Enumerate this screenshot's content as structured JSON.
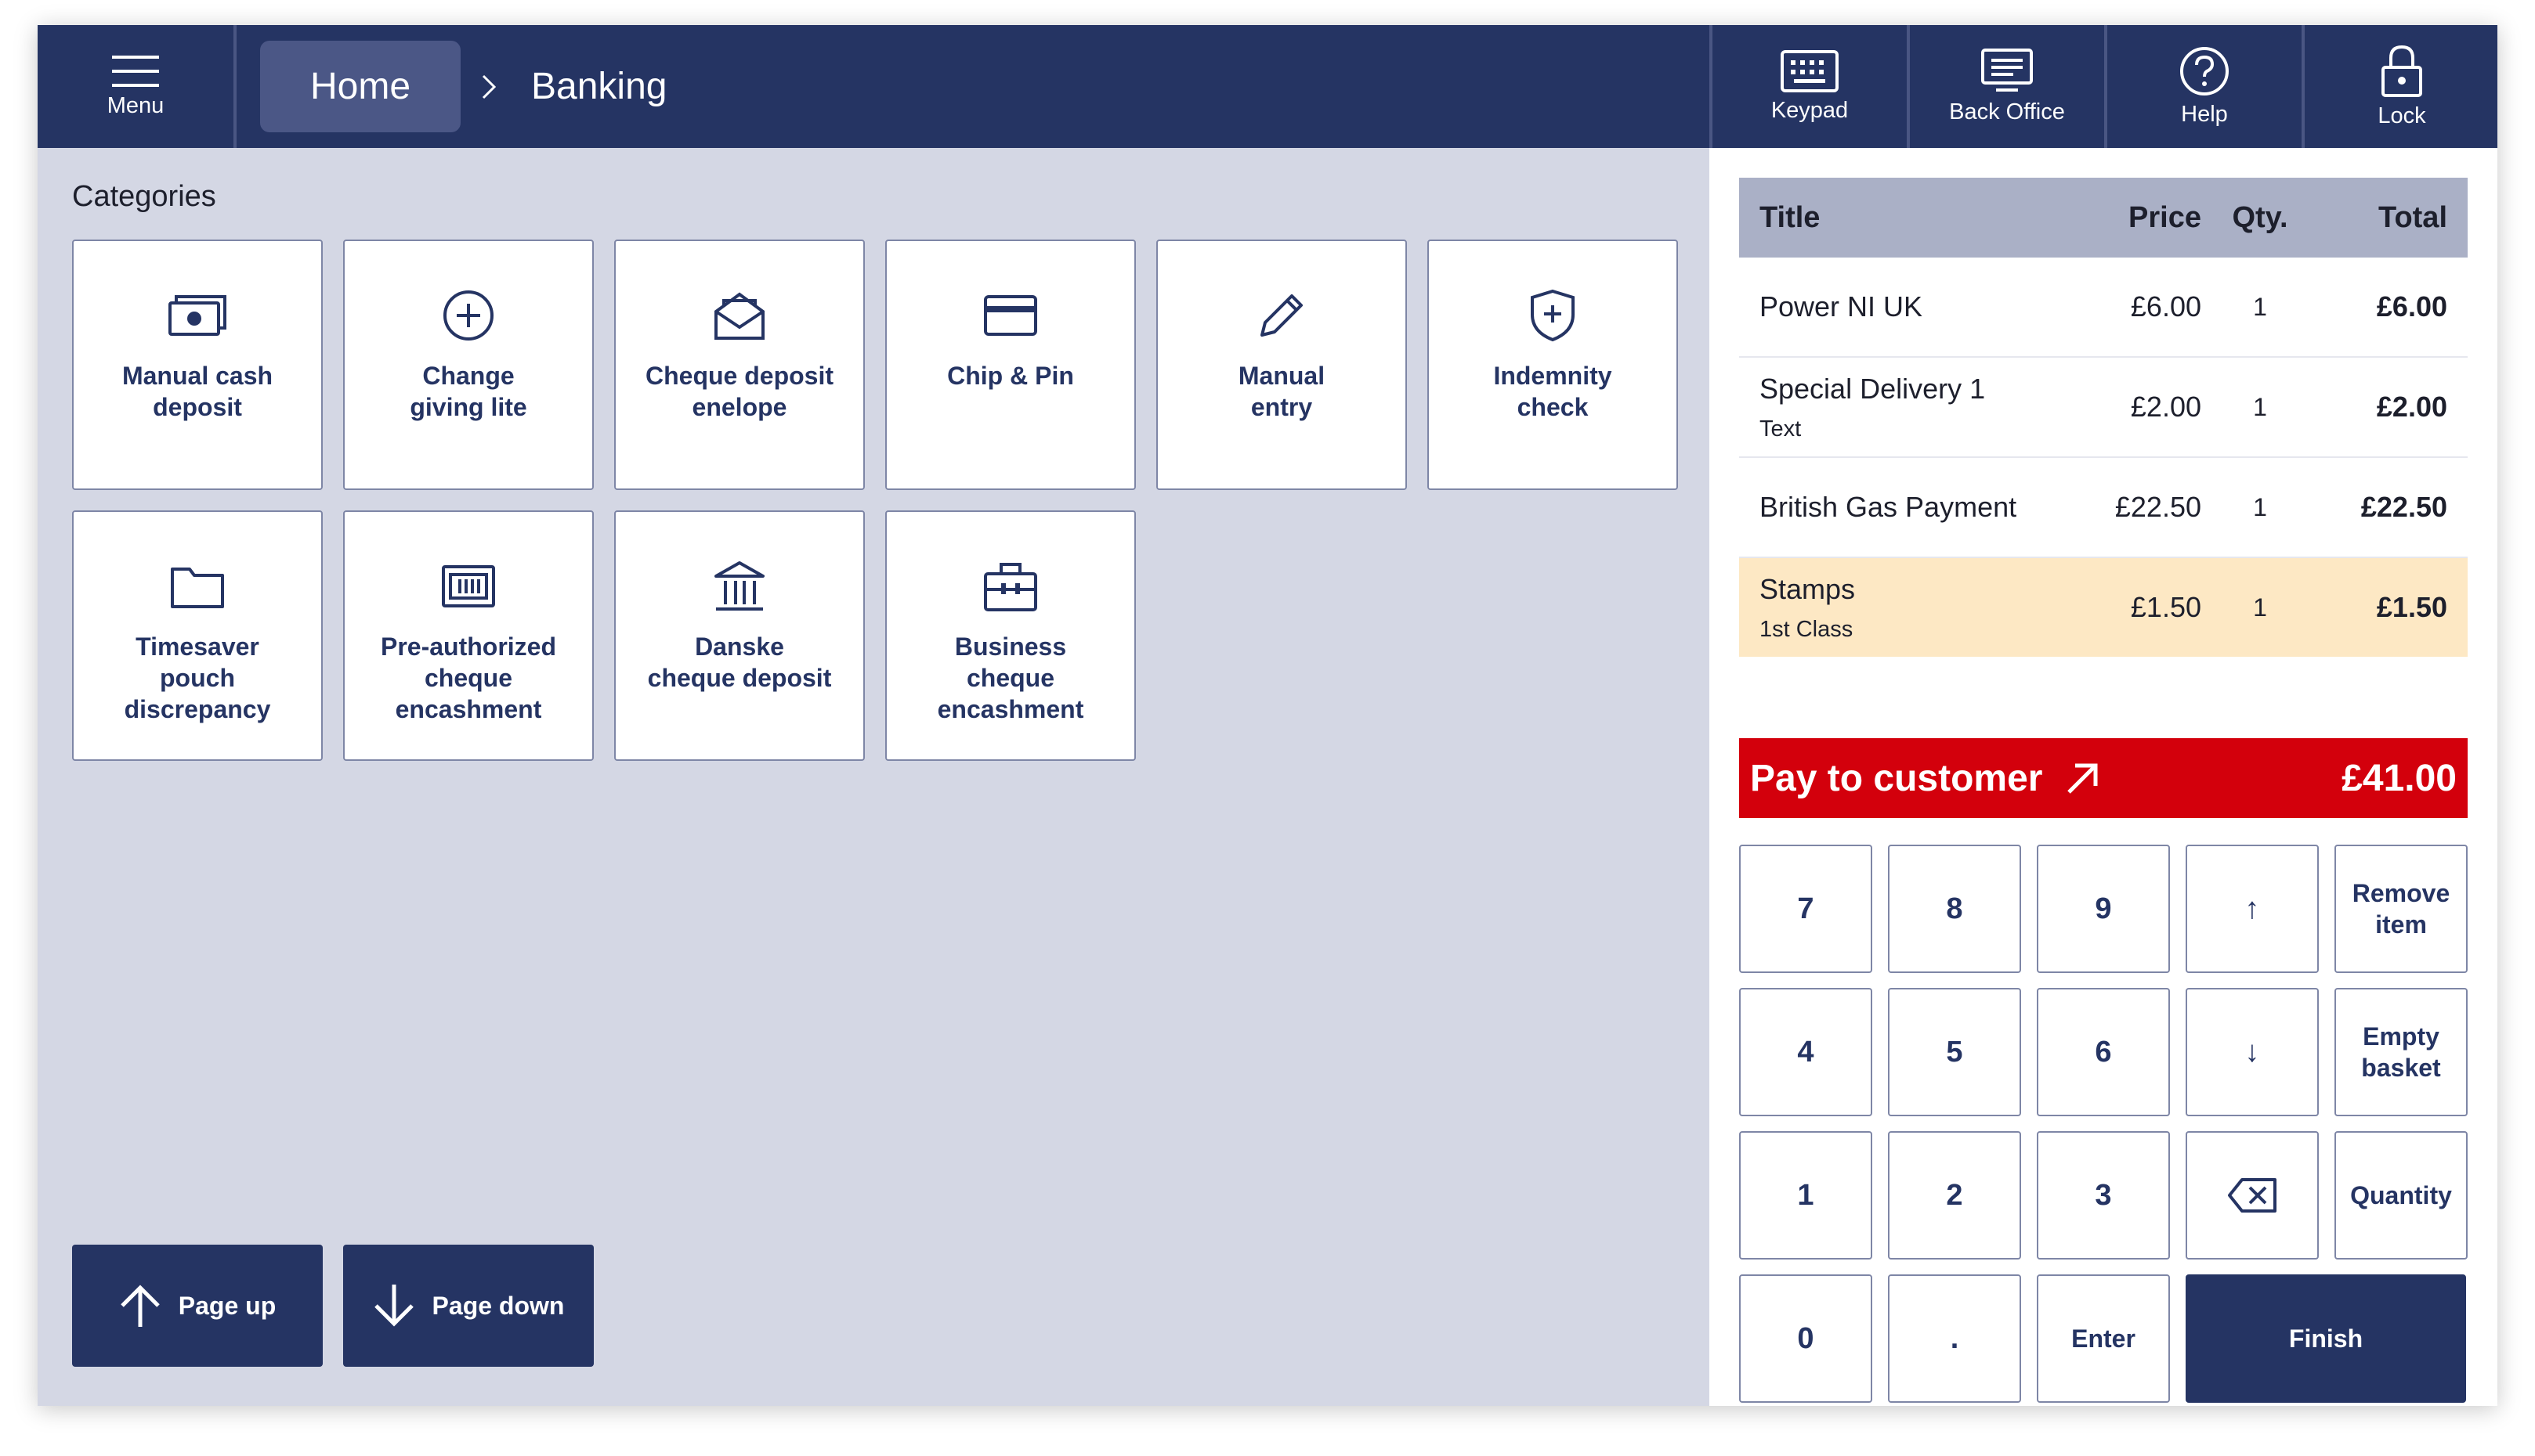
{
  "topbar": {
    "menu_label": "Menu",
    "home_label": "Home",
    "current_label": "Banking",
    "buttons": [
      {
        "label": "Keypad",
        "icon": "keyboard-icon"
      },
      {
        "label": "Back Office",
        "icon": "monitor-icon"
      },
      {
        "label": "Help",
        "icon": "help-icon"
      },
      {
        "label": "Lock",
        "icon": "lock-icon"
      }
    ]
  },
  "categories": {
    "title": "Categories",
    "tiles": [
      {
        "label": "Manual cash\ndeposit",
        "icon": "cash-icon"
      },
      {
        "label": "Change\ngiving lite",
        "icon": "plus-circle-icon"
      },
      {
        "label": "Cheque deposit\nenelope",
        "icon": "envelope-icon"
      },
      {
        "label": "Chip & Pin",
        "icon": "card-icon"
      },
      {
        "label": "Manual\nentry",
        "icon": "pencil-icon"
      },
      {
        "label": "Indemnity\ncheck",
        "icon": "shield-icon"
      },
      {
        "label": "Timesaver\npouch\ndiscrepancy",
        "icon": "folder-icon"
      },
      {
        "label": "Pre-authorized\ncheque\nencashment",
        "icon": "cheque-icon"
      },
      {
        "label": "Danske\ncheque deposit",
        "icon": "bank-icon"
      },
      {
        "label": "Business\ncheque\nencashment",
        "icon": "briefcase-icon"
      }
    ]
  },
  "pagination": {
    "page_up": "Page up",
    "page_down": "Page down"
  },
  "basket": {
    "headers": {
      "title": "Title",
      "price": "Price",
      "qty": "Qty.",
      "total": "Total"
    },
    "rows": [
      {
        "title": "Power NI UK",
        "subtitle": "",
        "price": "£6.00",
        "qty": "1",
        "total": "£6.00",
        "highlighted": false
      },
      {
        "title": "Special Delivery 1",
        "subtitle": "Text",
        "price": "£2.00",
        "qty": "1",
        "total": "£2.00",
        "highlighted": false
      },
      {
        "title": "British Gas Payment",
        "subtitle": "",
        "price": "£22.50",
        "qty": "1",
        "total": "£22.50",
        "highlighted": false
      },
      {
        "title": "Stamps",
        "subtitle": "1st Class",
        "price": "£1.50",
        "qty": "1",
        "total": "£1.50",
        "highlighted": true
      }
    ]
  },
  "pay": {
    "label": "Pay to customer",
    "amount": "£41.00"
  },
  "keypad": {
    "keys": [
      "7",
      "8",
      "9",
      "4",
      "5",
      "6",
      "1",
      "2",
      "3",
      "0",
      "."
    ],
    "up_arrow": "↑",
    "down_arrow": "↓",
    "remove_item": "Remove\nitem",
    "empty_basket": "Empty\nbasket",
    "quantity": "Quantity",
    "enter": "Enter",
    "finish": "Finish"
  },
  "colors": {
    "navy": "#253463",
    "panel_bg": "#d4d7e4",
    "pay_red": "#d3000c",
    "highlight_row": "#fde8c4",
    "header_grey": "#aab0c6"
  }
}
